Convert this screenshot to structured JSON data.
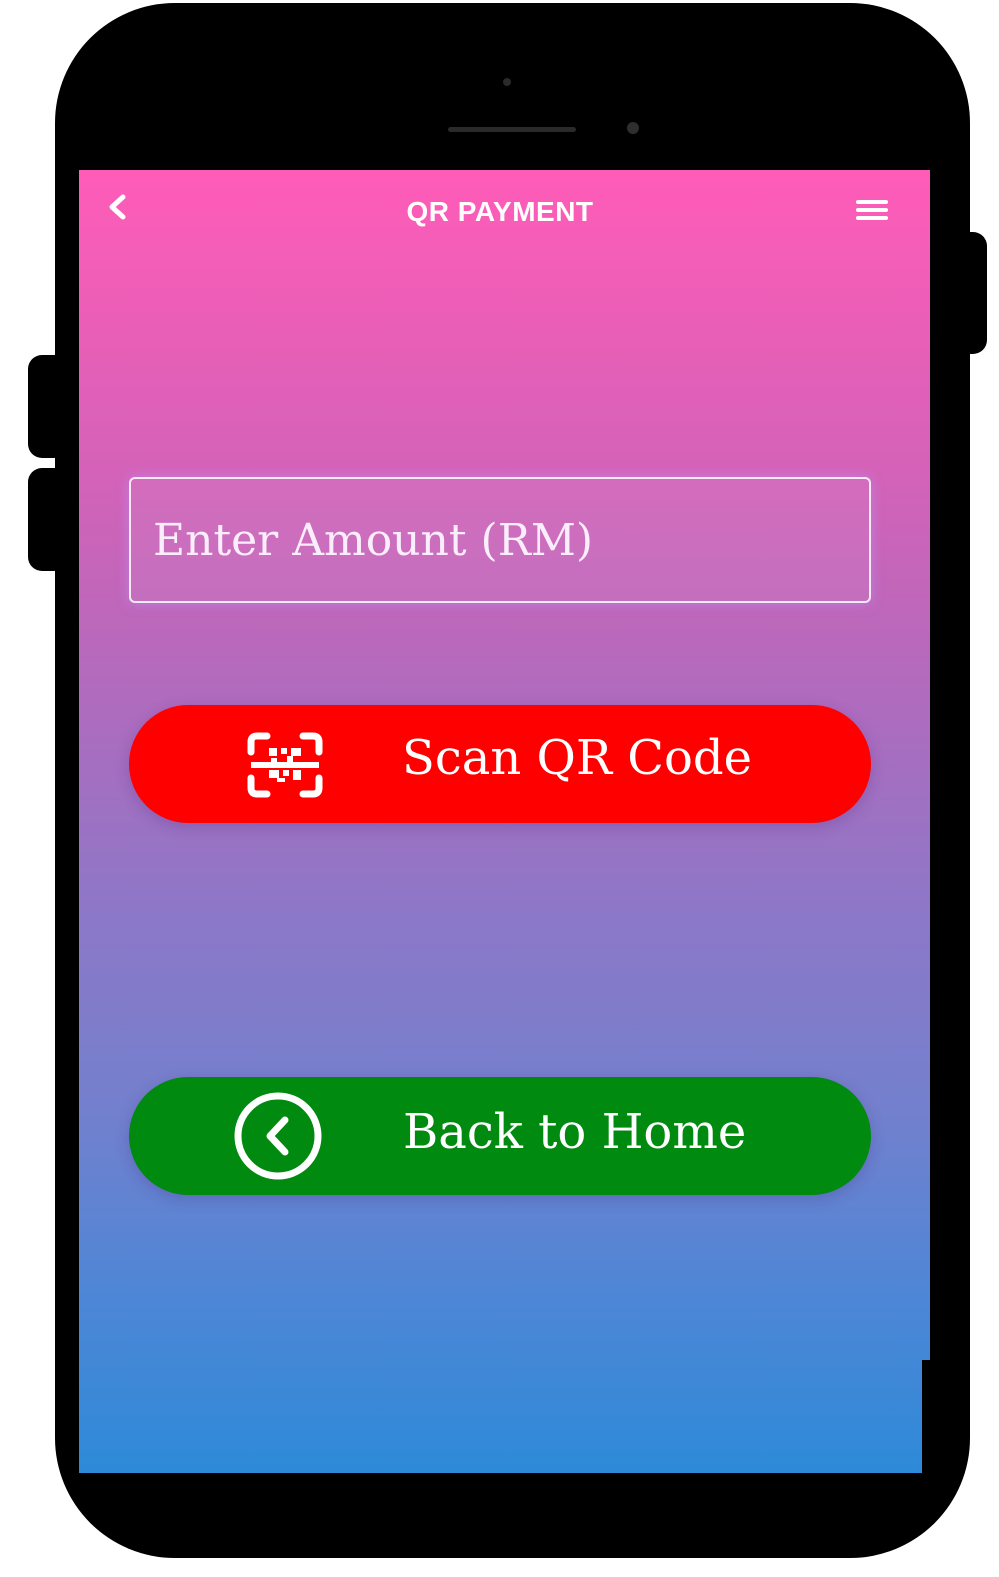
{
  "header": {
    "title": "QR PAYMENT",
    "back_icon": "chevron-left-icon",
    "menu_icon": "hamburger-menu-icon"
  },
  "amount": {
    "placeholder": "Enter Amount (RM)",
    "value": ""
  },
  "scan_button": {
    "label": "Scan QR Code",
    "icon": "qr-scan-icon",
    "color": "#ff0000"
  },
  "home_button": {
    "label": "Back to Home",
    "icon": "circle-chevron-left-icon",
    "color": "#008a10"
  },
  "theme": {
    "gradient_top": "#ff5cb8",
    "gradient_bottom": "#2d8ad8",
    "text": "#ffffff"
  }
}
